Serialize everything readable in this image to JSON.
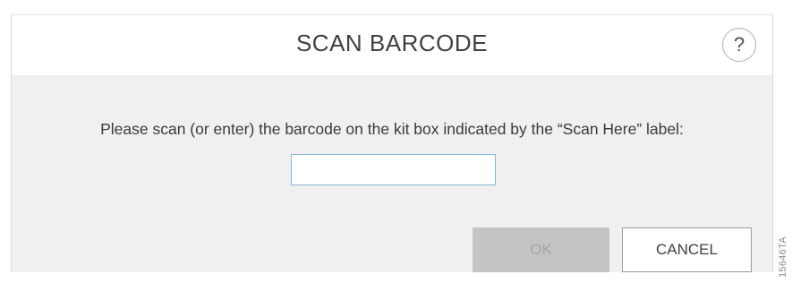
{
  "dialog": {
    "title": "SCAN BARCODE",
    "help_label": "?",
    "prompt": "Please scan (or enter) the barcode on the kit box indicated by the “Scan Here” label:",
    "barcode_input": {
      "value": "",
      "placeholder": ""
    },
    "ok_label": "OK",
    "ok_enabled": false,
    "cancel_label": "CANCEL"
  },
  "figure_id": "15646TA",
  "colors": {
    "body_background": "#f0f0f0",
    "header_background": "#ffffff",
    "ok_disabled_background": "#c4c4c4",
    "input_border": "#8fb4d8"
  },
  "icons": {
    "help": "help-icon"
  }
}
